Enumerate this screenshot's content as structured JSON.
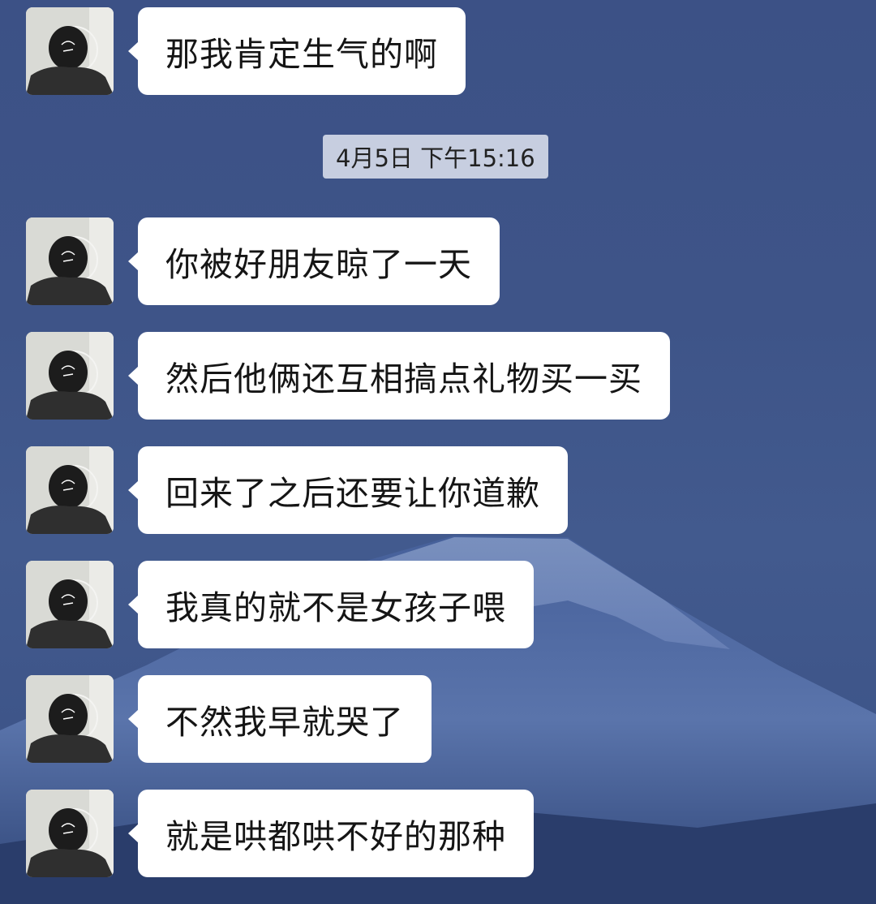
{
  "timestamp": "4月5日 下午15:16",
  "messages": [
    {
      "text": "那我肯定生气的啊"
    },
    {
      "text": "你被好朋友晾了一天"
    },
    {
      "text": "然后他俩还互相搞点礼物买一买"
    },
    {
      "text": "回来了之后还要让你道歉"
    },
    {
      "text": "我真的就不是女孩子喂"
    },
    {
      "text": "不然我早就哭了"
    },
    {
      "text": "就是哄都哄不好的那种"
    }
  ]
}
